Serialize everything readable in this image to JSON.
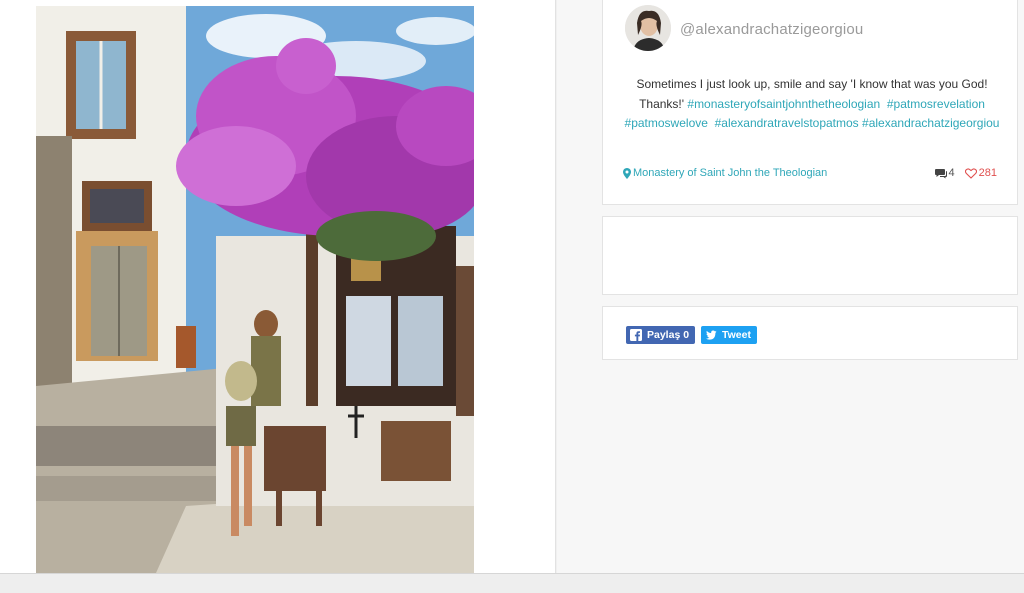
{
  "post": {
    "username": "@alexandrachatzigeorgiou",
    "caption_text": "Sometimes I just look up, smile and say 'I know that was you God! Thanks!'",
    "hashtags": [
      "#monasteryofsaintjohnthetheologian",
      "#patmosrevelation",
      "#patmoswelove",
      "#alexandratravelstopatmos",
      "#alexandrachatzigeorgiou"
    ],
    "location": "Monastery of Saint John the Theologian",
    "comments_count": "4",
    "likes_count": "281"
  },
  "share": {
    "facebook_label": "Paylaş 0",
    "twitter_label": "Tweet"
  },
  "icons": {
    "location": "map-pin-icon",
    "comments": "comment-icon",
    "likes": "heart-icon",
    "facebook": "facebook-icon",
    "twitter": "twitter-icon"
  },
  "colors": {
    "hashtag": "#2fa7b8",
    "like": "#e0504f",
    "facebook": "#4267b2",
    "twitter": "#1da1f2"
  }
}
